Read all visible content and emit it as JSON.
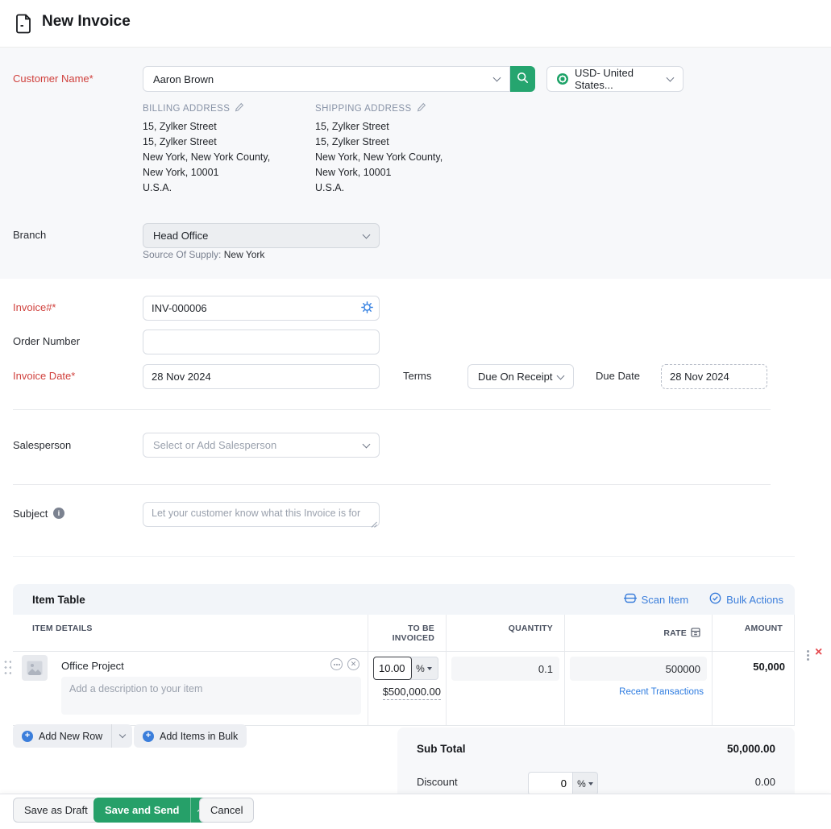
{
  "header": {
    "title": "New Invoice"
  },
  "customer": {
    "label": "Customer Name*",
    "name": "Aaron Brown",
    "currency": "USD- United States...",
    "billing": {
      "title": "BILLING ADDRESS",
      "lines": [
        "15, Zylker Street",
        "15, Zylker Street",
        "New York, New York County,",
        "New York, 10001",
        "U.S.A."
      ]
    },
    "shipping": {
      "title": "SHIPPING ADDRESS",
      "lines": [
        "15, Zylker Street",
        "15, Zylker Street",
        "New York, New York County,",
        "New York, 10001",
        "U.S.A."
      ]
    }
  },
  "branch": {
    "label": "Branch",
    "value": "Head Office",
    "source_label": "Source Of Supply:",
    "source_value": "New York"
  },
  "invoice": {
    "number_label": "Invoice#*",
    "number": "INV-000006",
    "order_label": "Order Number",
    "order_value": "",
    "date_label": "Invoice Date*",
    "date": "28 Nov 2024",
    "terms_label": "Terms",
    "terms": "Due On Receipt",
    "due_label": "Due Date",
    "due_date": "28 Nov 2024"
  },
  "salesperson": {
    "label": "Salesperson",
    "placeholder": "Select or Add Salesperson"
  },
  "subject": {
    "label": "Subject",
    "placeholder": "Let your customer know what this Invoice is for"
  },
  "item_table": {
    "title": "Item Table",
    "scan_item": "Scan Item",
    "bulk_actions": "Bulk Actions",
    "columns": [
      "ITEM DETAILS",
      "TO BE INVOICED",
      "QUANTITY",
      "RATE",
      "AMOUNT"
    ],
    "row": {
      "name": "Office Project",
      "description_placeholder": "Add a description to your item",
      "to_be_invoiced": "10.00",
      "to_be_invoiced_unit": "%",
      "invoiced_amount": "$500,000.00",
      "quantity": "0.1",
      "rate": "500000",
      "recent_transactions": "Recent Transactions",
      "amount": "50,000"
    },
    "add_new_row": "Add New Row",
    "add_items_in_bulk": "Add Items in Bulk"
  },
  "summary": {
    "sub_total_label": "Sub Total",
    "sub_total": "50,000.00",
    "discount_label": "Discount",
    "discount_value": "0",
    "discount_unit": "%",
    "discount_amount": "0.00"
  },
  "footer": {
    "save_draft": "Save as Draft",
    "save_send": "Save and Send",
    "cancel": "Cancel"
  },
  "icons": {
    "plus": "+",
    "info": "i",
    "delete": "×",
    "close_small": "✕"
  },
  "colors": {
    "accent_green": "#25a56f",
    "save_green": "#26a069",
    "link_blue": "#3b7edb",
    "label_red": "#d0413d",
    "delete_red": "#e5484d",
    "section_gray": "#f7f8fa"
  }
}
